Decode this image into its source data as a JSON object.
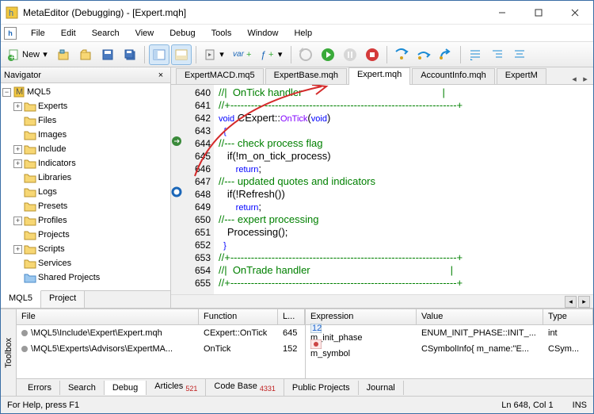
{
  "title": "MetaEditor (Debugging) - [Expert.mqh]",
  "menu": {
    "file": "File",
    "edit": "Edit",
    "search": "Search",
    "view": "View",
    "debug": "Debug",
    "tools": "Tools",
    "window": "Window",
    "help": "Help"
  },
  "toolbar": {
    "new": "New",
    "var": "var",
    "f": "ƒ"
  },
  "navigator": {
    "title": "Navigator",
    "close": "×",
    "root": "MQL5",
    "items": [
      "Experts",
      "Files",
      "Images",
      "Include",
      "Indicators",
      "Libraries",
      "Logs",
      "Presets",
      "Profiles",
      "Projects",
      "Scripts",
      "Services",
      "Shared Projects"
    ],
    "expandable": [
      true,
      false,
      false,
      true,
      true,
      false,
      false,
      false,
      true,
      false,
      true,
      false,
      false
    ],
    "shared_index": 12,
    "tabs": {
      "mql5": "MQL5",
      "project": "Project"
    }
  },
  "editor_tabs": [
    "ExpertMACD.mq5",
    "ExpertBase.mqh",
    "Expert.mqh",
    "AccountInfo.mqh",
    "ExpertM"
  ],
  "editor_active": 2,
  "code": {
    "start": 640,
    "lines": [
      {
        "t": "cmt",
        "v": "//|  OnTick handler                                                 |"
      },
      {
        "t": "cmt",
        "v": "//+------------------------------------------------------------------+"
      },
      {
        "t": "sig",
        "kw": "void",
        "cls": "CExpert::",
        "fn": "OnTick",
        "args": "(void)"
      },
      {
        "t": "br",
        "v": "  {"
      },
      {
        "t": "cmt",
        "v": "//--- check process flag"
      },
      {
        "t": "txt",
        "v": "   if(!m_on_tick_process)"
      },
      {
        "t": "ret",
        "v": "      return;"
      },
      {
        "t": "cmt",
        "v": "//--- updated quotes and indicators"
      },
      {
        "t": "txt",
        "v": "   if(!Refresh())"
      },
      {
        "t": "ret",
        "v": "      return;"
      },
      {
        "t": "cmt",
        "v": "//--- expert processing"
      },
      {
        "t": "txt",
        "v": "   Processing();"
      },
      {
        "t": "br",
        "v": "  }"
      },
      {
        "t": "cmt",
        "v": "//+------------------------------------------------------------------+"
      },
      {
        "t": "cmt",
        "v": "//|  OnTrade handler                                                 |"
      },
      {
        "t": "cmt",
        "v": "//+------------------------------------------------------------------+"
      }
    ],
    "bp": {
      "644": "arrow",
      "648": "circle"
    }
  },
  "stack": {
    "hdr": {
      "file": "File",
      "fn": "Function",
      "ln": "L..."
    },
    "rows": [
      {
        "file": "\\MQL5\\Include\\Expert\\Expert.mqh",
        "fn": "CExpert::OnTick",
        "ln": "645"
      },
      {
        "file": "\\MQL5\\Experts\\Advisors\\ExpertMA...",
        "fn": "OnTick",
        "ln": "152"
      }
    ]
  },
  "watch": {
    "hdr": {
      "expr": "Expression",
      "val": "Value",
      "type": "Type"
    },
    "rows": [
      {
        "expr": "m_init_phase",
        "val": "ENUM_INIT_PHASE::INIT_...",
        "type": "int",
        "icon": "num"
      },
      {
        "expr": "m_symbol",
        "val": "CSymbolInfo{ m_name:\"E...",
        "type": "CSym...",
        "icon": "obj"
      }
    ]
  },
  "bottom_tabs": [
    {
      "label": "Errors"
    },
    {
      "label": "Search"
    },
    {
      "label": "Debug",
      "active": true
    },
    {
      "label": "Articles",
      "badge": "521"
    },
    {
      "label": "Code Base",
      "badge": "4331"
    },
    {
      "label": "Public Projects"
    },
    {
      "label": "Journal"
    }
  ],
  "toolbox_label": "Toolbox",
  "status": {
    "help": "For Help, press F1",
    "pos": "Ln 648, Col 1",
    "ins": "INS"
  }
}
